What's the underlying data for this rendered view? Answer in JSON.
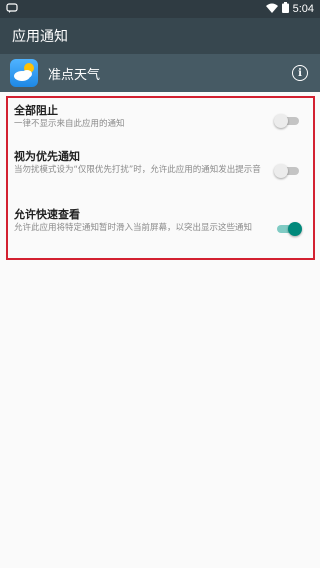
{
  "status_bar": {
    "time": "5:04",
    "left_icon": "notification-icon",
    "wifi_icon": "wifi-icon",
    "battery_icon": "battery-icon"
  },
  "app_bar": {
    "title": "应用通知"
  },
  "app": {
    "name": "准点天气",
    "icon": "weather-app-icon",
    "info_icon": "info-icon",
    "info_glyph": "i"
  },
  "settings": [
    {
      "title": "全部阻止",
      "description": "一律不显示来自此应用的通知",
      "enabled": false
    },
    {
      "title": "视为优先通知",
      "description": "当勿扰模式设为“仅限优先打扰”时，允许此应用的通知发出提示音",
      "enabled": false
    },
    {
      "title": "允许快速查看",
      "description": "允许此应用将特定通知暂时滑入当前屏幕，以突出显示这些通知",
      "enabled": true
    }
  ],
  "colors": {
    "status_bar": "#2f3b42",
    "app_bar": "#37474f",
    "app_row": "#465a64",
    "highlight_border": "#d32030",
    "toggle_on": "#00897b",
    "toggle_off": "#c4c4c4"
  }
}
